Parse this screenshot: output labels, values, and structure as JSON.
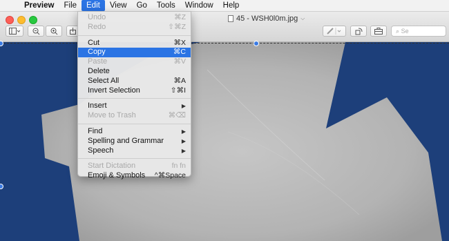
{
  "menubar": {
    "apple": "",
    "items": [
      "Preview",
      "File",
      "Edit",
      "View",
      "Go",
      "Tools",
      "Window",
      "Help"
    ]
  },
  "window": {
    "title": "45 - WSH0l0m.jpg",
    "search_placeholder": "Se"
  },
  "edit_menu": {
    "groups": [
      [
        {
          "label": "Undo",
          "shortcut": "⌘Z",
          "enabled": false
        },
        {
          "label": "Redo",
          "shortcut": "⇧⌘Z",
          "enabled": false
        }
      ],
      [
        {
          "label": "Cut",
          "shortcut": "⌘X",
          "enabled": true
        },
        {
          "label": "Copy",
          "shortcut": "⌘C",
          "enabled": true,
          "highlighted": true
        },
        {
          "label": "Paste",
          "shortcut": "⌘V",
          "enabled": false
        },
        {
          "label": "Delete",
          "shortcut": "",
          "enabled": true
        },
        {
          "label": "Select All",
          "shortcut": "⌘A",
          "enabled": true
        },
        {
          "label": "Invert Selection",
          "shortcut": "⇧⌘I",
          "enabled": true
        }
      ],
      [
        {
          "label": "Insert",
          "shortcut": "",
          "enabled": true,
          "submenu": true
        },
        {
          "label": "Move to Trash",
          "shortcut": "⌘⌫",
          "enabled": false
        }
      ],
      [
        {
          "label": "Find",
          "shortcut": "",
          "enabled": true,
          "submenu": true
        },
        {
          "label": "Spelling and Grammar",
          "shortcut": "",
          "enabled": true,
          "submenu": true
        },
        {
          "label": "Speech",
          "shortcut": "",
          "enabled": true,
          "submenu": true
        }
      ],
      [
        {
          "label": "Start Dictation",
          "shortcut": "fn fn",
          "enabled": false
        },
        {
          "label": "Emoji & Symbols",
          "shortcut": "^⌘Space",
          "enabled": true
        }
      ]
    ]
  },
  "colors": {
    "accent": "#2b74e4",
    "background_blue": "#1d3f7a",
    "stone_gray": "#b9b9b9"
  }
}
